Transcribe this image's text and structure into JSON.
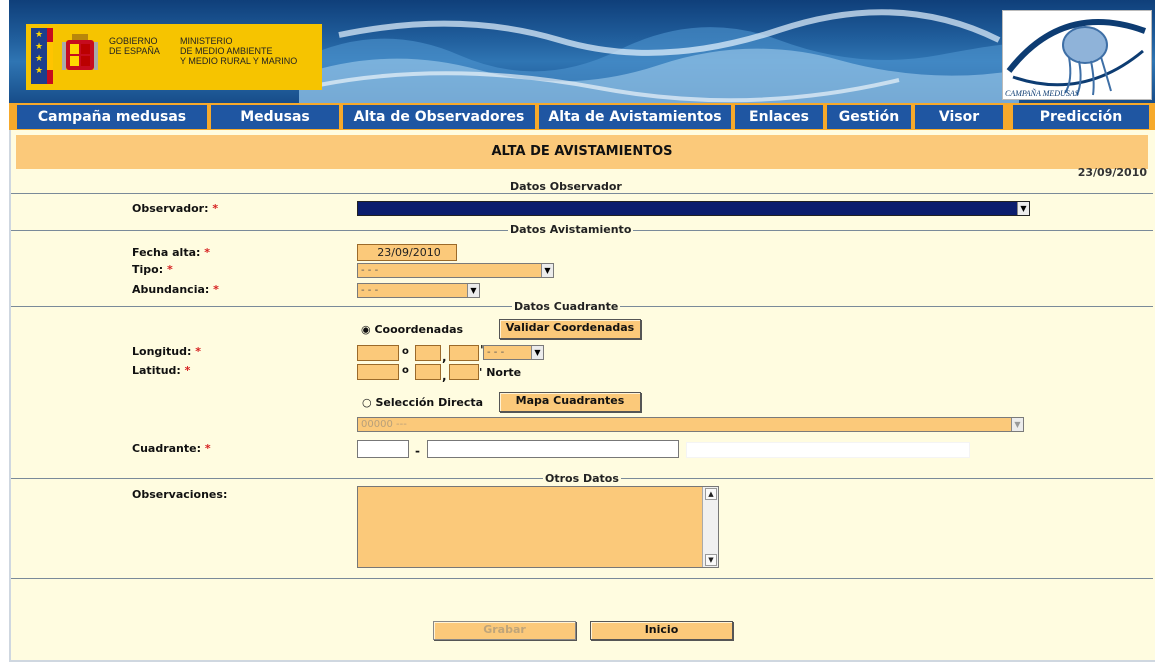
{
  "header": {
    "gov_line1": "GOBIERNO\nDE ESPAÑA",
    "gov_line2": "MINISTERIO\nDE MEDIO AMBIENTE\nY MEDIO RURAL Y MARINO",
    "logo_text": "CAMPAÑA MEDUSAS"
  },
  "nav": {
    "items": [
      {
        "label": "Campaña medusas"
      },
      {
        "label": "Medusas"
      },
      {
        "label": "Alta de Observadores"
      },
      {
        "label": "Alta de Avistamientos"
      },
      {
        "label": "Enlaces"
      },
      {
        "label": "Gestión"
      },
      {
        "label": "Visor"
      },
      {
        "label": "Predicción"
      }
    ]
  },
  "page": {
    "title": "ALTA DE AVISTAMIENTOS",
    "date": "23/09/2010"
  },
  "sections": {
    "observador": "Datos Observador",
    "avistamiento": "Datos Avistamiento",
    "cuadrante": "Datos Cuadrante",
    "otros": "Otros Datos"
  },
  "form": {
    "required_mark": "*",
    "observador_label": "Observador:",
    "fecha_label": "Fecha alta:",
    "fecha_value": "23/09/2010",
    "tipo_label": "Tipo:",
    "tipo_value": "- - -",
    "abundancia_label": "Abundancia:",
    "abundancia_value": "- - -",
    "coord_radio": "Cooordenadas",
    "validar_button": "Validar Coordenadas",
    "longitud_label": "Longitud:",
    "latitud_label": "Latitud:",
    "degree_mark": "o",
    "comma_mark": ",",
    "minute_mark": "'",
    "lon_dir_value": "- - -",
    "norte_label": "Norte",
    "seleccion_radio": "Selección Directa",
    "mapa_button": "Mapa Cuadrantes",
    "cuadrante_select_value": "00000 ---",
    "cuadrante_label": "Cuadrante:",
    "dash": "-",
    "observaciones_label": "Observaciones:",
    "grabar_button": "Grabar",
    "inicio_button": "Inicio"
  },
  "colors": {
    "nav_bg": "#1f56a2",
    "accent": "#f6a92b",
    "field_bg": "#fbc97a",
    "page_bg": "#fffce0"
  }
}
